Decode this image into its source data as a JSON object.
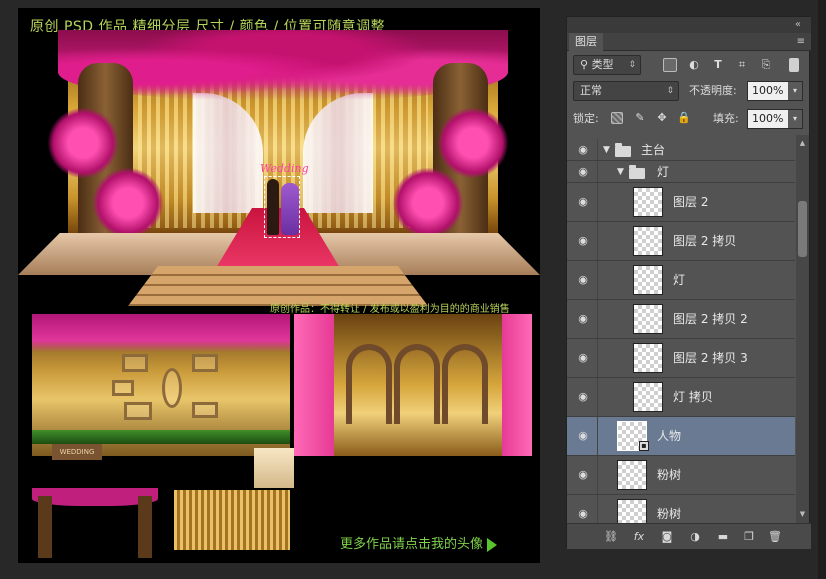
{
  "poster": {
    "title": "原创 PSD 作品  精细分层 尺寸 / 颜色 / 位置可随意调整",
    "notice": "原创作品：不得转让 / 发布或以盈利为目的的商业销售",
    "wedding_sign": "Wedding",
    "wood_sign": "WEDDING",
    "more_link": "更多作品请点击我的头像"
  },
  "panel": {
    "tab_label": "图层",
    "filter_kind": "类型",
    "blend_mode": "正常",
    "opacity_label": "不透明度:",
    "opacity_value": "100%",
    "lock_label": "锁定:",
    "fill_label": "填充:",
    "fill_value": "100%"
  },
  "layers": [
    {
      "name": "主台",
      "type": "group",
      "indent": 0,
      "expanded": true,
      "selected": false
    },
    {
      "name": "灯",
      "type": "group",
      "indent": 1,
      "expanded": true,
      "selected": false
    },
    {
      "name": "图层 2",
      "type": "layer",
      "indent": 2,
      "selected": false
    },
    {
      "name": "图层 2 拷贝",
      "type": "layer",
      "indent": 2,
      "selected": false
    },
    {
      "name": "灯",
      "type": "layer",
      "indent": 2,
      "selected": false
    },
    {
      "name": "图层 2 拷贝 2",
      "type": "layer",
      "indent": 2,
      "selected": false
    },
    {
      "name": "图层 2 拷贝 3",
      "type": "layer",
      "indent": 2,
      "selected": false
    },
    {
      "name": "灯 拷贝",
      "type": "layer",
      "indent": 2,
      "selected": false
    },
    {
      "name": "人物",
      "type": "layer",
      "indent": 1,
      "selected": true
    },
    {
      "name": "粉树",
      "type": "layer",
      "indent": 1,
      "selected": false
    },
    {
      "name": "粉树",
      "type": "layer",
      "indent": 1,
      "selected": false
    }
  ],
  "colors": {
    "title_green": "#b7d55a",
    "link_green": "#7fd24a",
    "selection_blue": "#6a7a93",
    "panel_gray": "#535353"
  },
  "icons": {
    "eye": "eye-icon",
    "folder": "folder-icon",
    "link": "link-icon",
    "fx": "fx-icon",
    "mask": "add-mask-icon",
    "adjust": "adjustment-layer-icon",
    "new_group": "new-group-icon",
    "new_layer": "new-layer-icon",
    "trash": "trash-icon"
  }
}
